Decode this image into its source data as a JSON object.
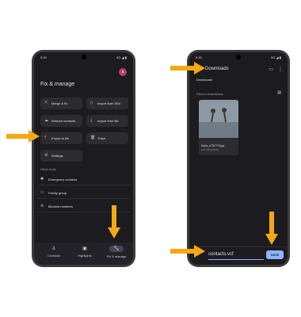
{
  "left_phone": {
    "status_time": "9:30",
    "status_right": "5G ◢ ▮",
    "title": "Fix & manage",
    "avatar_letter": "a",
    "chips": [
      {
        "label": "Merge & fix",
        "icon": "merge-icon"
      },
      {
        "label": "Import from SIM",
        "icon": "sim-icon"
      },
      {
        "label": "Restore contacts",
        "icon": "cloud-icon"
      },
      {
        "label": "Import from file",
        "icon": "download-icon"
      },
      {
        "label": "Export to file",
        "icon": "upload-icon"
      },
      {
        "label": "Trash",
        "icon": "trash-icon"
      },
      {
        "label": "Settings",
        "icon": "gear-icon"
      }
    ],
    "other_tools_label": "Other tools",
    "tools": [
      {
        "label": "Emergency contacts",
        "icon": "emergency-icon"
      },
      {
        "label": "Family group",
        "icon": "group-icon"
      },
      {
        "label": "Blocked numbers",
        "icon": "block-icon"
      }
    ],
    "nav": [
      {
        "label": "Contacts",
        "icon": "person-icon"
      },
      {
        "label": "Highlights",
        "icon": "highlights-icon"
      },
      {
        "label": "Fix & manage",
        "icon": "wrench-icon"
      }
    ]
  },
  "right_phone": {
    "status_time": "9:30",
    "status_right": "5G ◢ ▮",
    "title": "Downloads",
    "breadcrumb": "Downloads",
    "files_label": "Files in Downloads",
    "file_name": "Saint_4781770.jpg",
    "file_meta": "123 KB 9:08 PM",
    "filename_input": "contacts.vcf",
    "save_label": "SAVE"
  },
  "colors": {
    "accent_arrow": "#f5a814",
    "save_button": "#8fb3ff",
    "avatar": "#b83b6f"
  }
}
